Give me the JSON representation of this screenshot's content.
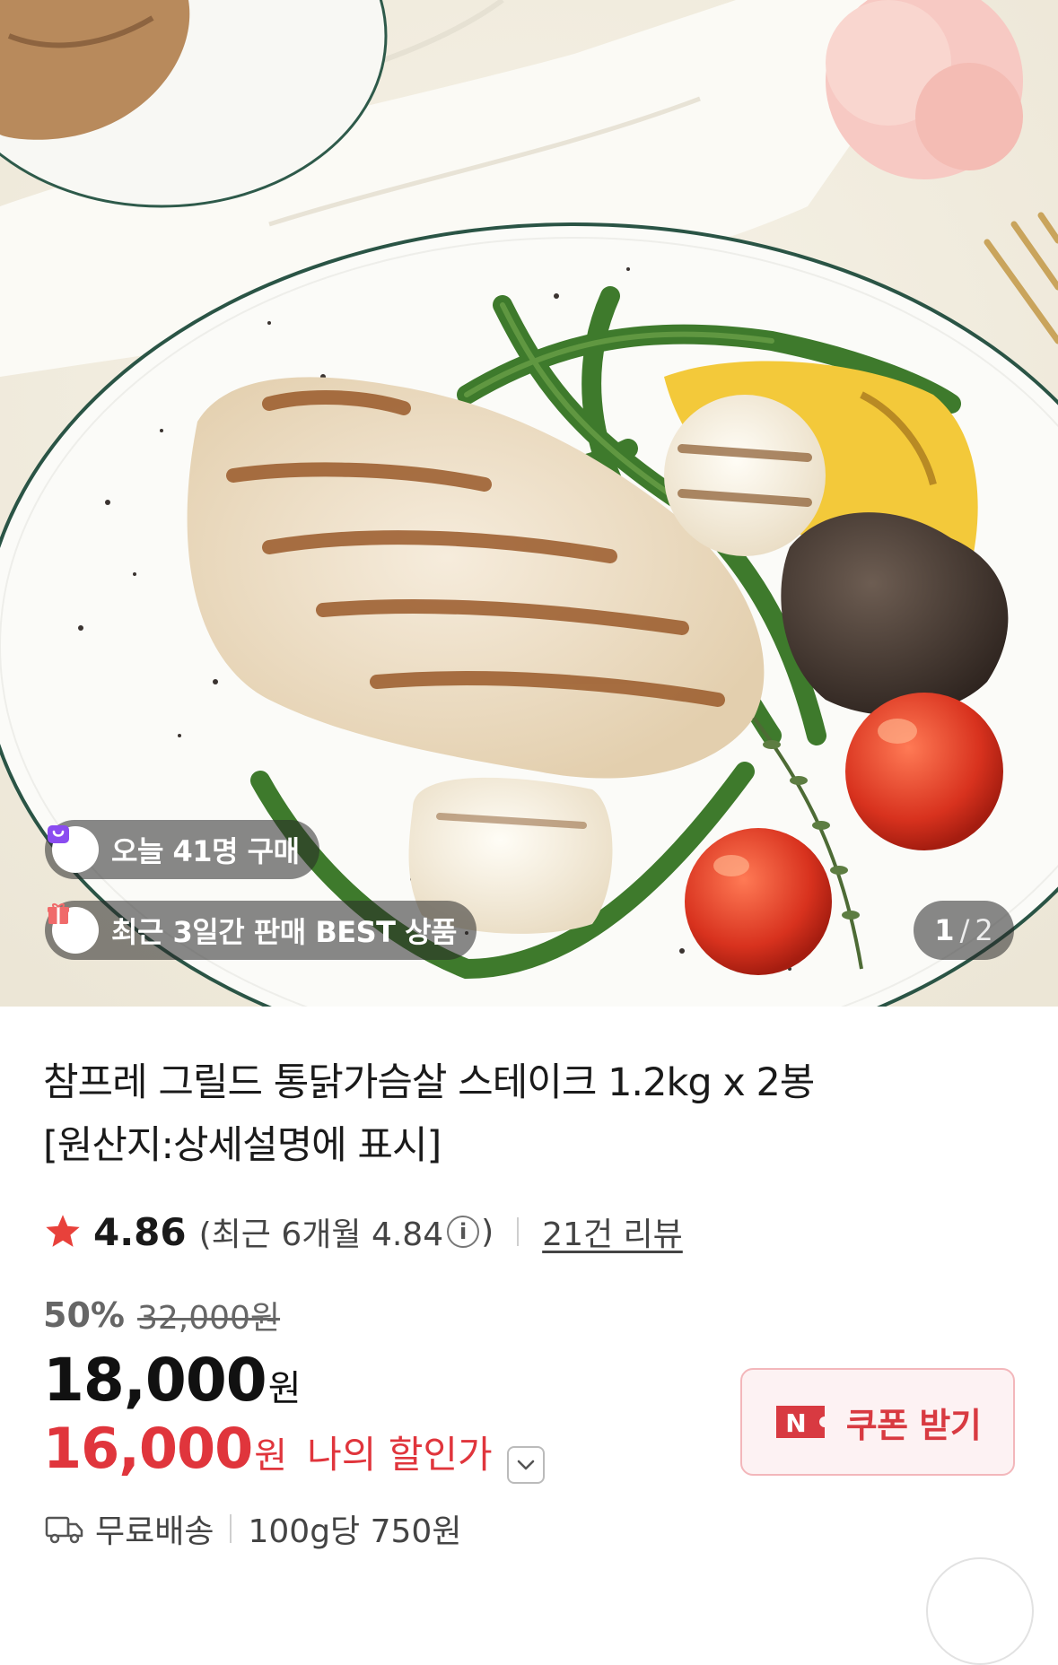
{
  "hero": {
    "badges": [
      {
        "icon": "shopping-bag-icon",
        "icon_color": "#8a4cf0",
        "text": "오늘 41명 구매"
      },
      {
        "icon": "gift-box-icon",
        "icon_color": "#f06a6a",
        "text": "최근 3일간 판매 BEST 상품"
      }
    ],
    "pager": {
      "current": "1",
      "separator": "/",
      "total": "2"
    }
  },
  "product": {
    "title_line1": "참프레 그릴드 통닭가슴살 스테이크 1.2kg x 2봉",
    "title_line2": "[원산지:상세설명에 표시]"
  },
  "rating": {
    "star_icon": "star-icon",
    "star_color": "#e8413b",
    "score": "4.86",
    "recent_open": "(최근 6개월 4.84",
    "info_icon_glyph": "i",
    "recent_close": ")",
    "reviews": "21건 리뷰"
  },
  "price": {
    "discount_percent": "50%",
    "original_price": "32,000원",
    "sale_price": "18,000",
    "sale_unit": "원",
    "my_price": "16,000",
    "my_unit": "원",
    "my_label": "나의 할인가",
    "accent_color": "#e0353c"
  },
  "coupon": {
    "logo_letter": "N",
    "label": "쿠폰 받기"
  },
  "shipping": {
    "icon": "truck-icon",
    "label": "무료배송",
    "unit_price": "100g당 750원"
  }
}
